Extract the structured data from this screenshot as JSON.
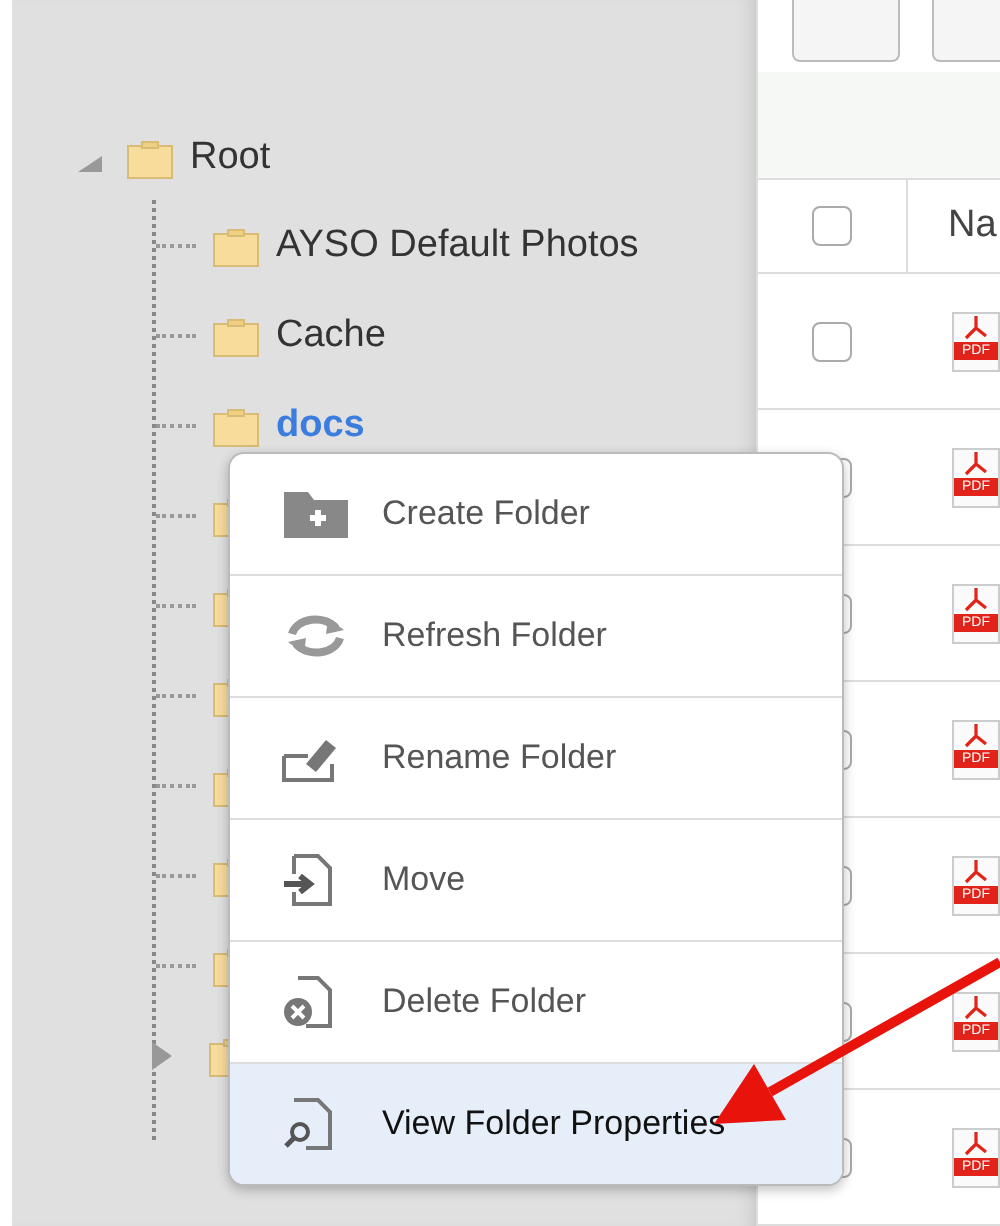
{
  "tree": {
    "label": "Root",
    "expanded": true,
    "children": [
      {
        "label": "AYSO Default Photos",
        "selected": false,
        "kind": "leaf"
      },
      {
        "label": "Cache",
        "selected": false,
        "kind": "leaf"
      },
      {
        "label": "docs",
        "selected": true,
        "kind": "leaf"
      },
      {
        "kind": "leaf"
      },
      {
        "kind": "leaf"
      },
      {
        "kind": "leaf"
      },
      {
        "kind": "leaf"
      },
      {
        "kind": "leaf"
      },
      {
        "kind": "leaf"
      },
      {
        "kind": "collapsed"
      }
    ]
  },
  "table": {
    "columns": [
      "Na"
    ],
    "header_checked": false,
    "rows": [
      {
        "checked": false,
        "file_badge": "PDF"
      },
      {
        "checked": false,
        "file_badge": "PDF"
      },
      {
        "checked": false,
        "file_badge": "PDF"
      },
      {
        "checked": false,
        "file_badge": "PDF"
      },
      {
        "checked": false,
        "file_badge": "PDF"
      },
      {
        "checked": false,
        "file_badge": "PDF"
      },
      {
        "checked": false,
        "file_badge": "PDF"
      }
    ]
  },
  "context_menu": {
    "items": [
      {
        "kind": "create",
        "label": "Create Folder",
        "selected": false
      },
      {
        "kind": "refresh",
        "label": "Refresh Folder",
        "selected": false
      },
      {
        "kind": "rename",
        "label": "Rename Folder",
        "selected": false
      },
      {
        "kind": "move",
        "label": "Move",
        "selected": false
      },
      {
        "kind": "delete",
        "label": "Delete Folder",
        "selected": false
      },
      {
        "kind": "properties",
        "label": "View Folder Properties",
        "selected": true
      }
    ]
  }
}
